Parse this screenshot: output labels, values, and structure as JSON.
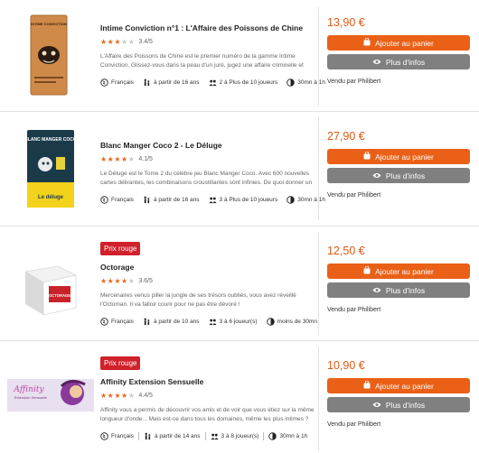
{
  "products": [
    {
      "badge": "",
      "title": "Intime Conviction n°1 : L'Affaire des Poissons de Chine",
      "rating": 3.4,
      "rating_text": "3.4/5",
      "desc": "L'Affaire des Poissons de Chine est le premier numéro de la gamme Intime Conviction. Glissez-vous dans la peau d'un juré, jugez une affaire criminelle et rendez votre verdict.",
      "language": "Français",
      "age": "à partir de 16 ans",
      "players": "2 à Plus de 10 joueurs",
      "duration": "30mn à 1h",
      "price": "13,90 €",
      "cart_label": "Ajouter au panier",
      "info_label": "Plus d'infos",
      "seller": "Vendu par Philibert"
    },
    {
      "badge": "",
      "title": "Blanc Manger Coco 2 - Le Déluge",
      "rating": 4.1,
      "rating_text": "4.1/5",
      "desc": "Le Déluge est le Tome 2 du célèbre jeu Blanc Manger Coco. Avec 600 nouvelles cartes délirantes, les combinaisons croustillantes sont infinies. De quoi donner un second so...",
      "language": "Français",
      "age": "à partir de 16 ans",
      "players": "3 à Plus de 10 joueurs",
      "duration": "30mn à 1h",
      "price": "27,90 €",
      "cart_label": "Ajouter au panier",
      "info_label": "Plus d'infos",
      "seller": "Vendu par Philibert"
    },
    {
      "badge": "Prix rouge",
      "title": "Octorage",
      "rating": 3.6,
      "rating_text": "3.6/5",
      "desc": "Mercenaires venus piller la jungle de ses trésors oubliés, vous avez réveillé l'Octoman. Il va falloir courir pour ne pas être dévoré !",
      "language": "Français",
      "age": "à partir de 10 ans",
      "players": "3 à 6 joueur(s)",
      "duration": "moins de 30mn",
      "price": "12,50 €",
      "cart_label": "Ajouter au panier",
      "info_label": "Plus d'infos",
      "seller": "Vendu par Philibert"
    },
    {
      "badge": "Prix rouge",
      "title": "Affinity Extension Sensuelle",
      "rating": 4.4,
      "rating_text": "4.4/5",
      "desc": "Affinity vous a permis de découvrir vos amis et de voir que vous étiez sur la même longueur d'onde... Mais est-ce dans tous les domaines, même les plus intimes ? Déco...",
      "language": "Français",
      "age": "à partir de 14 ans",
      "players": "3 à 8 joueur(s)",
      "duration": "30mn à 1h",
      "price": "10,90 €",
      "cart_label": "Ajouter au panier",
      "info_label": "Plus d'infos",
      "seller": "Vendu par Philibert"
    }
  ],
  "colors": {
    "accent": "#ea6017",
    "price": "#e05a12",
    "info_button": "#808080",
    "badge": "#d0202a",
    "star": "#e26a1f"
  },
  "icons": {
    "language": "globe-icon",
    "age": "age-figures-icon",
    "players": "players-icon",
    "duration": "clock-icon",
    "cart": "bag-icon",
    "info": "eye-icon"
  },
  "box_art_text": {
    "p1": "INTIME CONVICTION",
    "p2_top": "BLANC MANGER COCO",
    "p2_bottom": "Le déluge",
    "p3": "OCTORAGE",
    "p4_top": "Affinity",
    "p4_sub": "Extension Sensuelle"
  }
}
